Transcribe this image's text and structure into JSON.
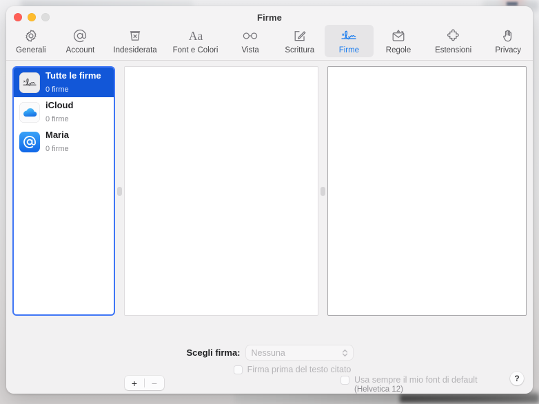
{
  "window": {
    "title": "Firme",
    "controls": [
      {
        "name": "close",
        "color": "#ff5f57"
      },
      {
        "name": "minimize",
        "color": "#febc2e"
      },
      {
        "name": "zoom",
        "color": "#dddddd"
      }
    ]
  },
  "toolbar": {
    "accent": "#1479ef",
    "tabs": [
      {
        "id": "generali",
        "label": "Generali",
        "icon": "gear-icon",
        "selected": false
      },
      {
        "id": "account",
        "label": "Account",
        "icon": "at-icon",
        "selected": false
      },
      {
        "id": "indesiderata",
        "label": "Indesiderata",
        "icon": "junk-bin-icon",
        "selected": false
      },
      {
        "id": "font-colori",
        "label": "Font e Colori",
        "icon": "font-aa-icon",
        "selected": false
      },
      {
        "id": "vista",
        "label": "Vista",
        "icon": "glasses-icon",
        "selected": false
      },
      {
        "id": "scrittura",
        "label": "Scrittura",
        "icon": "compose-icon",
        "selected": false
      },
      {
        "id": "firme",
        "label": "Firme",
        "icon": "signature-icon",
        "selected": true
      },
      {
        "id": "regole",
        "label": "Regole",
        "icon": "rules-mail-icon",
        "selected": false
      },
      {
        "id": "estensioni",
        "label": "Estensioni",
        "icon": "puzzle-icon",
        "selected": false
      },
      {
        "id": "privacy",
        "label": "Privacy",
        "icon": "hand-icon",
        "selected": false
      }
    ]
  },
  "sidebar": {
    "selection_color": "#1257d8",
    "items": [
      {
        "title": "Tutte le firme",
        "subtitle": "0 firme",
        "icon": "signature-icon",
        "selected": true
      },
      {
        "title": "iCloud",
        "subtitle": "0 firme",
        "icon": "icloud-icon",
        "selected": false
      },
      {
        "title": "Maria",
        "subtitle": "0 firme",
        "icon": "at-mail-icon",
        "selected": false
      }
    ]
  },
  "signature_controls": {
    "add_label": "+",
    "remove_label": "−"
  },
  "font_option": {
    "checkbox_label": "Usa sempre il mio font di default",
    "checked": false,
    "detail": "(Helvetica 12)"
  },
  "bottom": {
    "choose_label": "Scegli firma:",
    "choose_value": "Nessuna",
    "quote_label": "Firma prima del testo citato",
    "quote_checked": false,
    "help_label": "?"
  }
}
